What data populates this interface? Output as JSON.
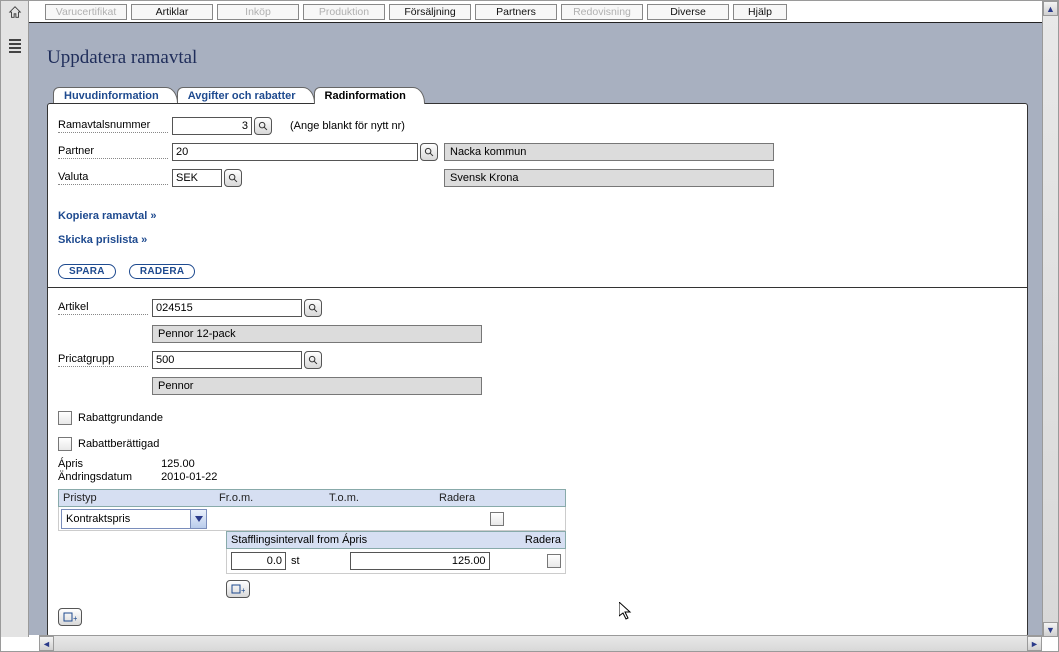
{
  "menubar": {
    "items": [
      {
        "label": "Varucertifikat",
        "disabled": true
      },
      {
        "label": "Artiklar",
        "disabled": false
      },
      {
        "label": "Inköp",
        "disabled": true
      },
      {
        "label": "Produktion",
        "disabled": true
      },
      {
        "label": "Försäljning",
        "disabled": false
      },
      {
        "label": "Partners",
        "disabled": false
      },
      {
        "label": "Redovisning",
        "disabled": true
      },
      {
        "label": "Diverse",
        "disabled": false
      },
      {
        "label": "Hjälp",
        "disabled": false
      }
    ]
  },
  "page": {
    "title": "Uppdatera ramavtal"
  },
  "tabs": [
    {
      "label": "Huvudinformation",
      "active": false
    },
    {
      "label": "Avgifter och rabatter",
      "active": false
    },
    {
      "label": "Radinformation",
      "active": true
    }
  ],
  "head": {
    "ramavtal_label": "Ramavtalsnummer",
    "ramavtal_value": "3",
    "ramavtal_hint": "(Ange blankt för nytt nr)",
    "partner_label": "Partner",
    "partner_value": "20",
    "partner_name": "Nacka kommun",
    "valuta_label": "Valuta",
    "valuta_value": "SEK",
    "valuta_name": "Svensk Krona"
  },
  "links": {
    "kopiera": "Kopiera ramavtal »",
    "skicka": "Skicka prislista »"
  },
  "buttons": {
    "spara": "SPARA",
    "radera": "RADERA"
  },
  "line": {
    "artikel_label": "Artikel",
    "artikel_value": "024515",
    "artikel_desc": "Pennor 12-pack",
    "pricat_label": "Pricatgrupp",
    "pricat_value": "500",
    "pricat_desc": "Pennor",
    "rabattgrundande": "Rabattgrundande",
    "rabattberattigad": "Rabattberättigad",
    "apris_label": "Ápris",
    "apris_value": "125.00",
    "andring_label": "Ändringsdatum",
    "andring_value": "2010-01-22"
  },
  "pricetable": {
    "col_pristyp": "Pristyp",
    "col_from": "Fr.o.m.",
    "col_tom": "T.o.m.",
    "col_radera": "Radera",
    "row": {
      "pristyp": "Kontraktspris",
      "from": "",
      "tom": ""
    }
  },
  "staff": {
    "head_left": "Stafflingsintervall from Ápris",
    "head_right": "Radera",
    "interval": "0.0",
    "unit": "st",
    "apris": "125.00"
  }
}
